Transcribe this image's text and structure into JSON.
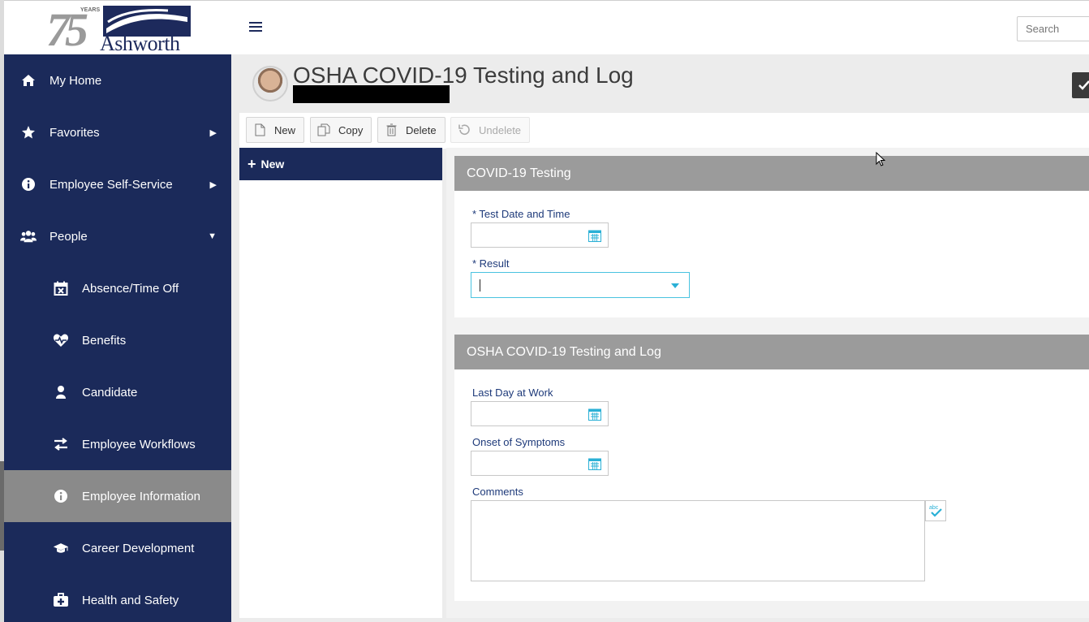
{
  "header": {
    "logo_number": "75",
    "logo_years": "YEARS",
    "logo_name": "Ashworth",
    "search_placeholder": "Search"
  },
  "sidebar": {
    "items": [
      {
        "label": "My Home",
        "icon": "home-icon"
      },
      {
        "label": "Favorites",
        "icon": "star-icon",
        "arrow": "right"
      },
      {
        "label": "Employee Self-Service",
        "icon": "info-icon",
        "arrow": "right"
      },
      {
        "label": "People",
        "icon": "people-icon",
        "arrow": "down"
      },
      {
        "label": "Absence/Time Off",
        "icon": "calendar-x-icon"
      },
      {
        "label": "Benefits",
        "icon": "heartbeat-icon"
      },
      {
        "label": "Candidate",
        "icon": "person-icon"
      },
      {
        "label": "Employee Workflows",
        "icon": "exchange-arrows-icon"
      },
      {
        "label": "Employee Information",
        "icon": "info-icon",
        "active": true
      },
      {
        "label": "Career Development",
        "icon": "graduation-cap-icon"
      },
      {
        "label": "Health and Safety",
        "icon": "first-aid-kit-icon"
      }
    ]
  },
  "page": {
    "title": "OSHA COVID-19 Testing and Log"
  },
  "toolbar": {
    "new_label": "New",
    "copy_label": "Copy",
    "delete_label": "Delete",
    "undelete_label": "Undelete"
  },
  "list_panel": {
    "new_label": "New"
  },
  "sections": {
    "testing": {
      "title": "COVID-19 Testing",
      "test_date_label": "* Test Date and Time",
      "result_label": "* Result",
      "result_value": ""
    },
    "log": {
      "title": "OSHA COVID-19 Testing and Log",
      "last_day_label": "Last Day at Work",
      "onset_label": "Onset of Symptoms",
      "comments_label": "Comments",
      "comments_value": ""
    }
  },
  "colors": {
    "sidebar_bg": "#1b2a5a",
    "active_item_bg": "#8a8a8a",
    "section_header_bg": "#9b9b9b",
    "label_color": "#1e3a7a",
    "accent": "#2ab0d6"
  }
}
